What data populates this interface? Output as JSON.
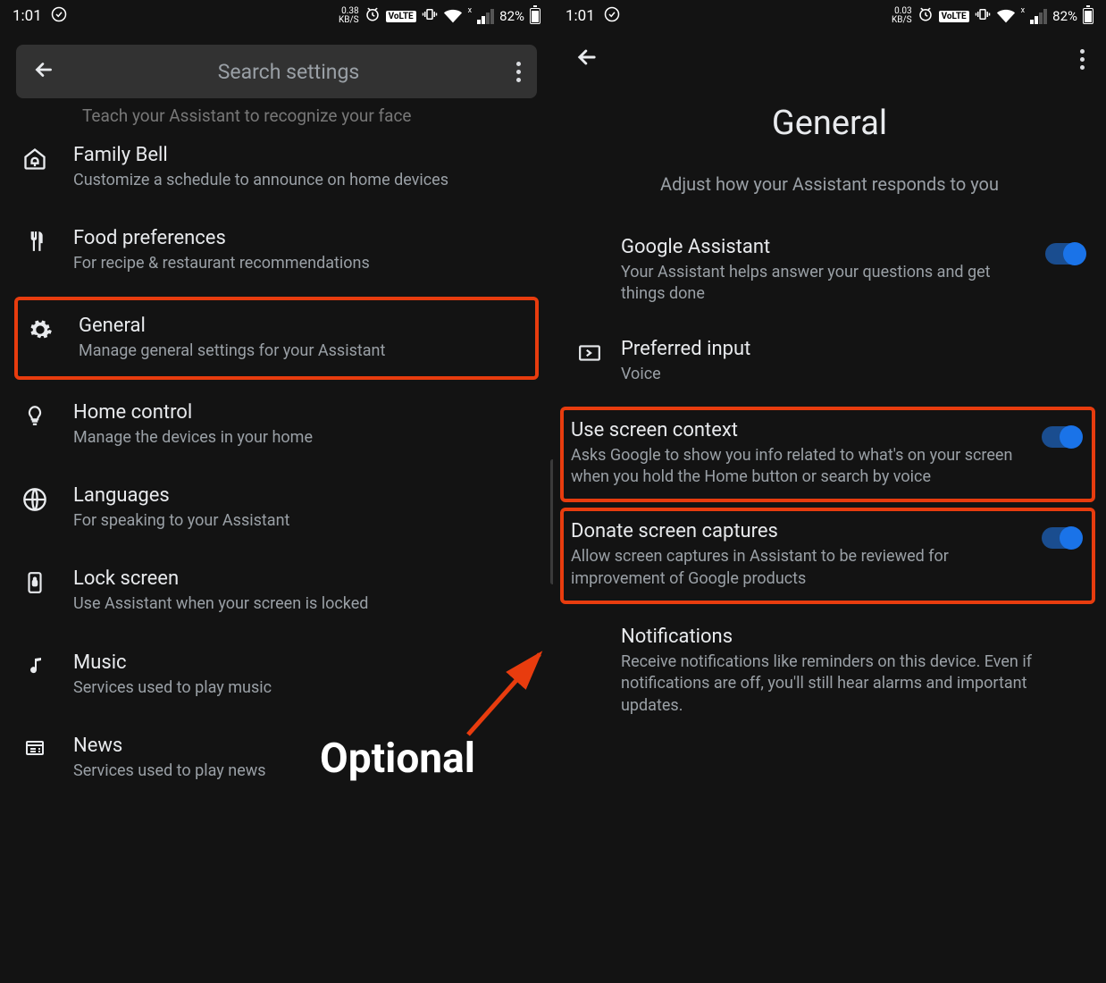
{
  "status": {
    "time": "1:01",
    "kbs_left": "0.38",
    "kbs_right": "0.03",
    "kbs_unit": "KB/S",
    "volte": "VoLTE",
    "battery_pct": "82%"
  },
  "left": {
    "search_placeholder": "Search settings",
    "cutoff_text": "Teach your Assistant to recognize your face",
    "items": [
      {
        "title": "Family Bell",
        "sub": "Customize a schedule to announce on home devices"
      },
      {
        "title": "Food preferences",
        "sub": "For recipe & restaurant recommendations"
      },
      {
        "title": "General",
        "sub": "Manage general settings for your Assistant"
      },
      {
        "title": "Home control",
        "sub": "Manage the devices in your home"
      },
      {
        "title": "Languages",
        "sub": "For speaking to your Assistant"
      },
      {
        "title": "Lock screen",
        "sub": "Use Assistant when your screen is locked"
      },
      {
        "title": "Music",
        "sub": "Services used to play music"
      },
      {
        "title": "News",
        "sub": "Services used to play news"
      }
    ]
  },
  "right": {
    "title": "General",
    "subtitle": "Adjust how your Assistant responds to you",
    "items": [
      {
        "title": "Google Assistant",
        "sub": "Your Assistant helps answer your questions and get things done",
        "toggle": true
      },
      {
        "title": "Preferred input",
        "sub": "Voice"
      },
      {
        "title": "Use screen context",
        "sub": "Asks Google to show you info related to what's on your screen when you hold the Home button or search by voice",
        "toggle": true
      },
      {
        "title": "Donate screen captures",
        "sub": "Allow screen captures in Assistant to be reviewed for improvement of Google products",
        "toggle": true
      },
      {
        "title": "Notifications",
        "sub": "Receive notifications like reminders on this device. Even if notifications are off, you'll still hear alarms and important updates."
      }
    ]
  },
  "annotation": {
    "optional": "Optional"
  },
  "colors": {
    "highlight": "#e83c0e",
    "accent": "#1a73e8"
  }
}
